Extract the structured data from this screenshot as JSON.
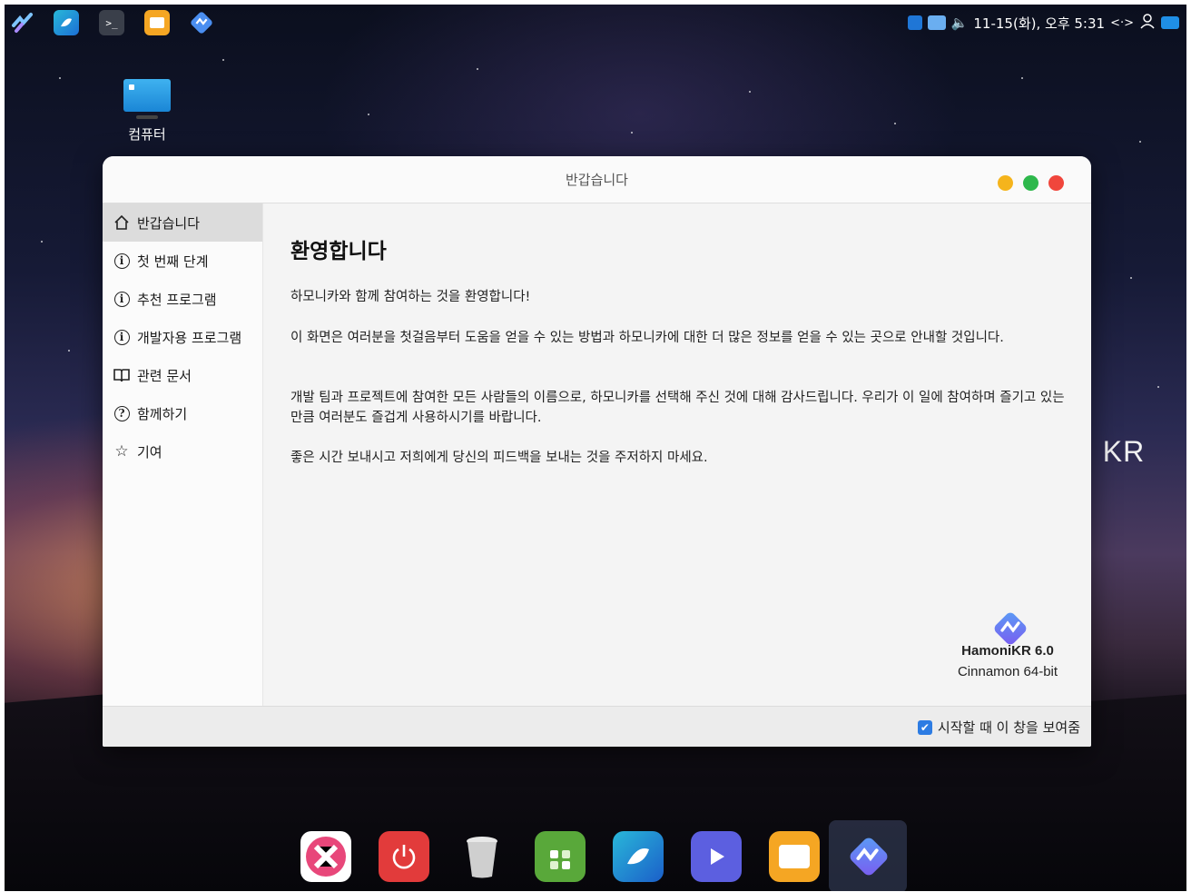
{
  "panel": {
    "launchers": [
      "hamonikr-menu-icon",
      "mail-app-icon",
      "terminal-icon",
      "files-icon",
      "hamonikr-welcome-icon"
    ],
    "clock": "11-15(화), 오후 5:31",
    "network_glyph": "<·>",
    "volume_glyph": "🔈"
  },
  "desktop": {
    "computer_label": "컴퓨터",
    "wallpaper_text": "I KR"
  },
  "window": {
    "title": "반갑습니다",
    "controls": {
      "minimize_color": "#f5b41c",
      "maximize_color": "#2eb84c",
      "close_color": "#f0463c"
    }
  },
  "sidebar": {
    "items": [
      {
        "label": "반갑습니다",
        "icon": "home-icon",
        "active": true
      },
      {
        "label": "첫 번째 단계",
        "icon": "info-icon",
        "active": false
      },
      {
        "label": "추천 프로그램",
        "icon": "info-icon",
        "active": false
      },
      {
        "label": "개발자용 프로그램",
        "icon": "info-icon",
        "active": false
      },
      {
        "label": "관련 문서",
        "icon": "book-icon",
        "active": false
      },
      {
        "label": "함께하기",
        "icon": "help-icon",
        "active": false
      },
      {
        "label": "기여",
        "icon": "star-icon",
        "active": false
      }
    ]
  },
  "content": {
    "heading": "환영합니다",
    "paragraphs": [
      "하모니카와 함께 참여하는 것을 환영합니다!",
      "이 화면은 여러분을 첫걸음부터 도움을 얻을 수 있는 방법과 하모니카에 대한 더 많은 정보를 얻을 수 있는 곳으로 안내할 것입니다.",
      "개발 팀과 프로젝트에 참여한 모든 사람들의 이름으로, 하모니카를 선택해 주신 것에 대해 감사드립니다. 우리가 이 일에 참여하며 즐기고 있는 만큼 여러분도 즐겁게 사용하시기를 바랍니다.",
      "좋은 시간 보내시고 저희에게 당신의 피드백을 보내는 것을 주저하지 마세요."
    ],
    "brand_name": "HamoniKR 6.0",
    "brand_sub": "Cinnamon 64-bit"
  },
  "footer": {
    "startup_label": "시작할 때 이 창을 보여줌",
    "startup_checked": true
  },
  "dock": {
    "items": [
      "hamonikr-community-icon",
      "power-icon",
      "trash-icon",
      "software-manager-icon",
      "mail-app-icon",
      "media-player-icon",
      "files-icon",
      "hamonikr-welcome-icon"
    ]
  }
}
